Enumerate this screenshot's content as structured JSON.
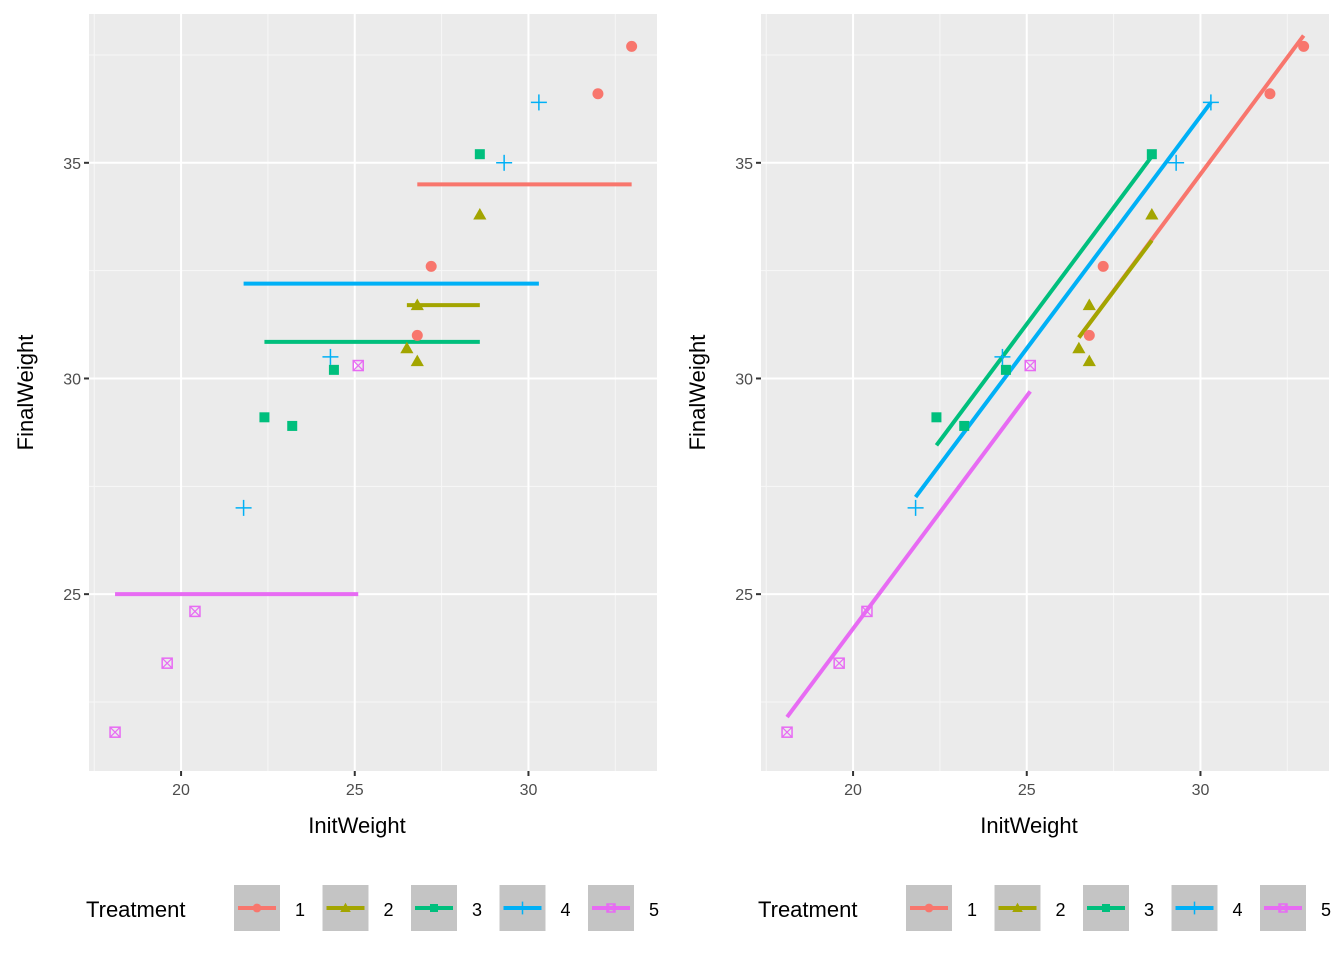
{
  "chart_data": [
    {
      "type": "scatter",
      "title": "",
      "xlabel": "InitWeight",
      "ylabel": "FinalWeight",
      "xlim": [
        17.35,
        33.7
      ],
      "ylim": [
        20.9,
        38.45
      ],
      "xticks": [
        20,
        25,
        30
      ],
      "yticks": [
        25,
        30,
        35
      ],
      "grid": true,
      "legend_title": "Treatment",
      "legend_position": "bottom",
      "overlay": "group-mean horizontal segments",
      "series": [
        {
          "name": "1",
          "color": "#F8766D",
          "shape": "circle",
          "points": [
            [
              32.97,
              37.7
            ],
            [
              32.0,
              36.6
            ],
            [
              27.2,
              32.6
            ],
            [
              26.8,
              31.0
            ]
          ],
          "line": {
            "x": [
              26.8,
              32.97
            ],
            "y": [
              34.5,
              34.5
            ]
          }
        },
        {
          "name": "2",
          "color": "#A3A500",
          "shape": "triangle",
          "points": [
            [
              28.6,
              33.8
            ],
            [
              26.8,
              31.7
            ],
            [
              26.5,
              30.7
            ],
            [
              26.8,
              30.4
            ]
          ],
          "line": {
            "x": [
              26.5,
              28.6
            ],
            "y": [
              31.7,
              31.7
            ]
          }
        },
        {
          "name": "3",
          "color": "#00BF7D",
          "shape": "square",
          "points": [
            [
              28.6,
              35.2
            ],
            [
              24.4,
              30.2
            ],
            [
              22.4,
              29.1
            ],
            [
              23.2,
              28.9
            ]
          ],
          "line": {
            "x": [
              22.4,
              28.6
            ],
            "y": [
              30.85,
              30.85
            ]
          }
        },
        {
          "name": "4",
          "color": "#00B0F6",
          "shape": "plus",
          "points": [
            [
              30.3,
              36.4
            ],
            [
              29.3,
              35.0
            ],
            [
              24.3,
              30.5
            ],
            [
              21.8,
              27.0
            ]
          ],
          "line": {
            "x": [
              21.8,
              30.3
            ],
            "y": [
              32.2,
              32.2
            ]
          }
        },
        {
          "name": "5",
          "color": "#E76BF3",
          "shape": "square-cross",
          "points": [
            [
              25.1,
              30.3
            ],
            [
              20.4,
              24.6
            ],
            [
              19.6,
              23.4
            ],
            [
              18.1,
              21.8
            ]
          ],
          "line": {
            "x": [
              18.1,
              25.1
            ],
            "y": [
              25.0,
              25.0
            ]
          }
        }
      ]
    },
    {
      "type": "scatter",
      "title": "",
      "xlabel": "InitWeight",
      "ylabel": "FinalWeight",
      "xlim": [
        17.35,
        33.7
      ],
      "ylim": [
        20.9,
        38.45
      ],
      "xticks": [
        20,
        25,
        30
      ],
      "yticks": [
        25,
        30,
        35
      ],
      "grid": true,
      "legend_title": "Treatment",
      "legend_position": "bottom",
      "overlay": "parallel fitted regression lines",
      "series": [
        {
          "name": "1",
          "color": "#F8766D",
          "shape": "circle",
          "points": [
            [
              32.97,
              37.7
            ],
            [
              32.0,
              36.6
            ],
            [
              27.2,
              32.6
            ],
            [
              26.8,
              31.0
            ]
          ],
          "line": {
            "x": [
              26.5,
              32.97
            ],
            "y": [
              30.95,
              37.95
            ]
          }
        },
        {
          "name": "2",
          "color": "#A3A500",
          "shape": "triangle",
          "points": [
            [
              28.6,
              33.8
            ],
            [
              26.8,
              31.7
            ],
            [
              26.5,
              30.7
            ],
            [
              26.8,
              30.4
            ]
          ],
          "line": {
            "x": [
              26.5,
              28.6
            ],
            "y": [
              30.95,
              33.2
            ]
          }
        },
        {
          "name": "3",
          "color": "#00BF7D",
          "shape": "square",
          "points": [
            [
              28.6,
              35.2
            ],
            [
              24.4,
              30.2
            ],
            [
              22.4,
              29.1
            ],
            [
              23.2,
              28.9
            ]
          ],
          "line": {
            "x": [
              22.4,
              28.6
            ],
            "y": [
              28.45,
              35.15
            ]
          }
        },
        {
          "name": "4",
          "color": "#00B0F6",
          "shape": "plus",
          "points": [
            [
              30.3,
              36.4
            ],
            [
              29.3,
              35.0
            ],
            [
              24.3,
              30.5
            ],
            [
              21.8,
              27.0
            ]
          ],
          "line": {
            "x": [
              21.8,
              30.3
            ],
            "y": [
              27.25,
              36.4
            ]
          }
        },
        {
          "name": "5",
          "color": "#E76BF3",
          "shape": "square-cross",
          "points": [
            [
              25.1,
              30.3
            ],
            [
              20.4,
              24.6
            ],
            [
              19.6,
              23.4
            ],
            [
              18.1,
              21.8
            ]
          ],
          "line": {
            "x": [
              18.1,
              25.1
            ],
            "y": [
              22.15,
              29.7
            ]
          }
        }
      ]
    }
  ]
}
